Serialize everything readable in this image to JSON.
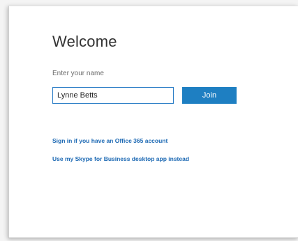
{
  "welcome": {
    "title": "Welcome",
    "name_label": "Enter your name",
    "name_value": "Lynne Betts",
    "join_label": "Join",
    "links": [
      "Sign in if you have an Office 365 account",
      "Use my Skype for Business desktop app instead"
    ]
  },
  "colors": {
    "accent": "#1e7fc2",
    "link": "#1b68b3"
  }
}
